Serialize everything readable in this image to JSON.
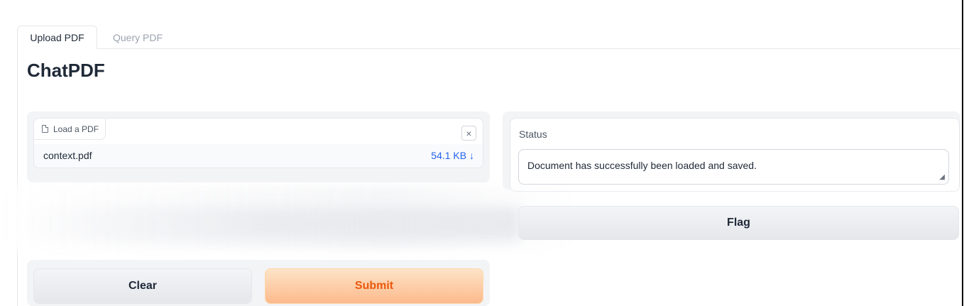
{
  "tabs": [
    {
      "label": "Upload PDF",
      "active": true
    },
    {
      "label": "Query PDF",
      "active": false
    }
  ],
  "page_title": "ChatPDF",
  "upload": {
    "label": "Load a PDF",
    "file_name": "context.pdf",
    "file_size": "54.1 KB ↓",
    "close_symbol": "×"
  },
  "status": {
    "label": "Status",
    "value": "Document has successfully been loaded and saved."
  },
  "buttons": {
    "flag": "Flag",
    "clear": "Clear",
    "submit": "Submit"
  },
  "colors": {
    "accent": "#ea580c",
    "link": "#2563eb"
  }
}
